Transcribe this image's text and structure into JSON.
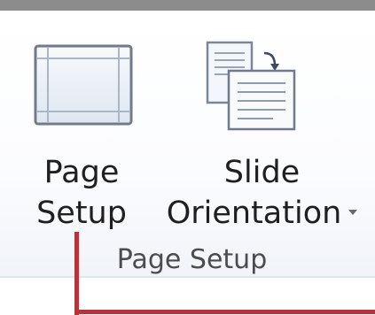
{
  "ribbon": {
    "group": {
      "title": "Page Setup",
      "buttons": [
        {
          "id": "page-setup",
          "label_line1": "Page",
          "label_line2": "Setup",
          "icon": "page-setup-icon",
          "has_dropdown": false
        },
        {
          "id": "slide-orientation",
          "label_line1": "Slide",
          "label_line2": "Orientation",
          "icon": "slide-orientation-icon",
          "has_dropdown": true
        }
      ]
    }
  },
  "colors": {
    "label_text": "#1f1f1f",
    "group_title_text": "#4c4c4c",
    "annotation": "#b5343c",
    "icon_border": "#6f7b8b",
    "icon_fill": "#dde6f1"
  }
}
